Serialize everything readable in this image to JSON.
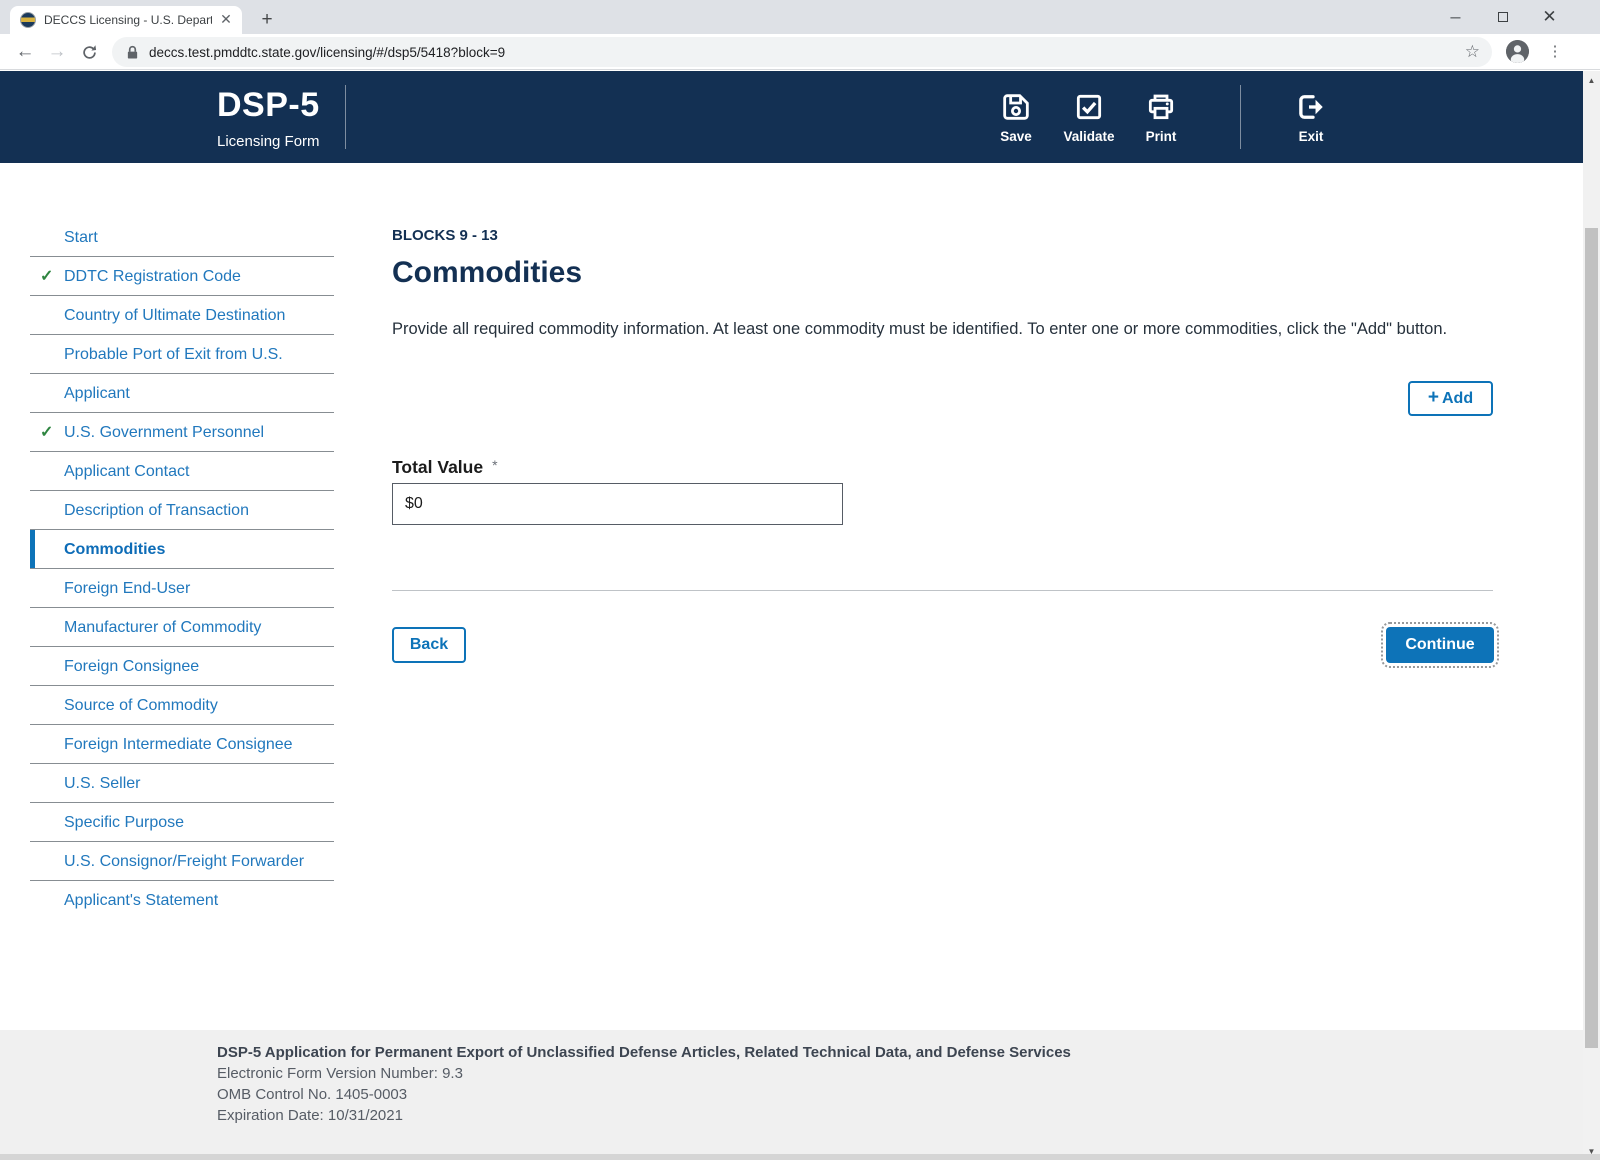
{
  "browser": {
    "tab_title": "DECCS Licensing - U.S. Departme",
    "url": "deccs.test.pmddtc.state.gov/licensing/#/dsp5/5418?block=9"
  },
  "header": {
    "title": "DSP-5",
    "subtitle": "Licensing Form",
    "actions": [
      {
        "label": "Save",
        "icon": "floppy-disk-icon"
      },
      {
        "label": "Validate",
        "icon": "checkbox-check-icon"
      },
      {
        "label": "Print",
        "icon": "printer-icon"
      }
    ],
    "exit_label": "Exit"
  },
  "sidebar": {
    "items": [
      {
        "label": "Start",
        "completed": false,
        "active": false
      },
      {
        "label": "DDTC Registration Code",
        "completed": true,
        "active": false
      },
      {
        "label": "Country of Ultimate Destination",
        "completed": false,
        "active": false
      },
      {
        "label": "Probable Port of Exit from U.S.",
        "completed": false,
        "active": false
      },
      {
        "label": "Applicant",
        "completed": false,
        "active": false
      },
      {
        "label": "U.S. Government Personnel",
        "completed": true,
        "active": false
      },
      {
        "label": "Applicant Contact",
        "completed": false,
        "active": false
      },
      {
        "label": "Description of Transaction",
        "completed": false,
        "active": false
      },
      {
        "label": "Commodities",
        "completed": false,
        "active": true
      },
      {
        "label": "Foreign End-User",
        "completed": false,
        "active": false
      },
      {
        "label": "Manufacturer of Commodity",
        "completed": false,
        "active": false
      },
      {
        "label": "Foreign Consignee",
        "completed": false,
        "active": false
      },
      {
        "label": "Source of Commodity",
        "completed": false,
        "active": false
      },
      {
        "label": "Foreign Intermediate Consignee",
        "completed": false,
        "active": false
      },
      {
        "label": "U.S. Seller",
        "completed": false,
        "active": false
      },
      {
        "label": "Specific Purpose",
        "completed": false,
        "active": false
      },
      {
        "label": "U.S. Consignor/Freight Forwarder",
        "completed": false,
        "active": false
      },
      {
        "label": "Applicant's Statement",
        "completed": false,
        "active": false
      }
    ]
  },
  "main": {
    "blocks_label": "BLOCKS 9 - 13",
    "title": "Commodities",
    "description": "Provide all required commodity information. At least one commodity must be identified. To enter one or more commodities, click the \"Add\" button.",
    "add_label": "Add",
    "total_value": {
      "label": "Total Value",
      "required_mark": "*",
      "value": "$0"
    },
    "back_label": "Back",
    "continue_label": "Continue"
  },
  "footer": {
    "title": "DSP-5 Application for Permanent Export of Unclassified Defense Articles, Related Technical Data, and Defense Services",
    "lines": [
      "Electronic Form Version Number: 9.3",
      "OMB Control No. 1405-0003",
      "Expiration Date: 10/31/2021"
    ]
  },
  "colors": {
    "header_navy": "#133053",
    "accent_blue": "#0d73b8",
    "link_blue": "#2178bd",
    "check_green": "#2e8540",
    "footer_gray": "#f0f0f0"
  }
}
